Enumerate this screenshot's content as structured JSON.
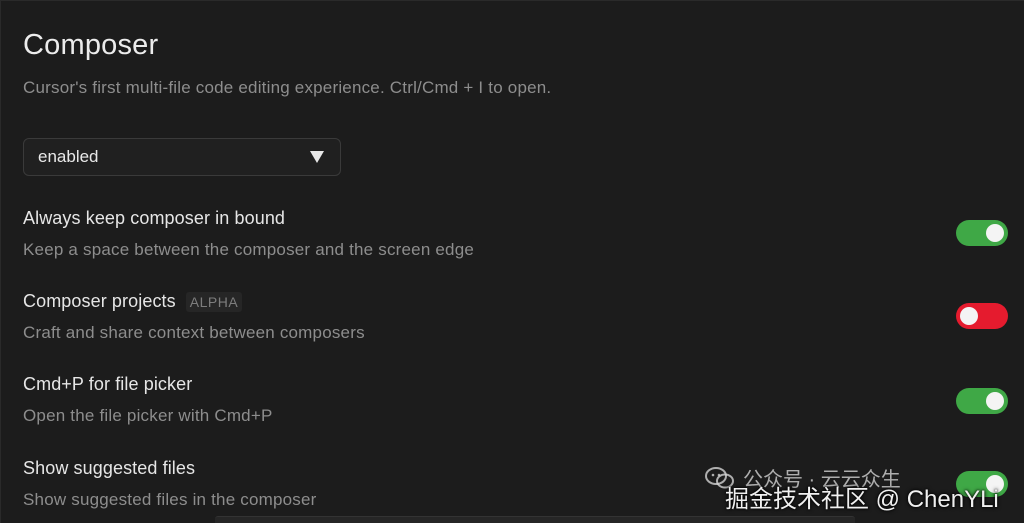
{
  "section": {
    "title": "Composer",
    "subtitle": "Cursor's first multi-file code editing experience. Ctrl/Cmd + I to open."
  },
  "mode_select": {
    "value": "enabled"
  },
  "settings": [
    {
      "label": "Always keep composer in bound",
      "description": "Keep a space between the composer and the screen edge",
      "badge": "",
      "enabled": true
    },
    {
      "label": "Composer projects",
      "description": "Craft and share context between composers",
      "badge": "ALPHA",
      "enabled": false
    },
    {
      "label": "Cmd+P for file picker",
      "description": "Open the file picker with Cmd+P",
      "badge": "",
      "enabled": true
    },
    {
      "label": "Show suggested files",
      "description": "Show suggested files in the composer",
      "badge": "",
      "enabled": true
    }
  ],
  "colors": {
    "toggle_on": "#3fa846",
    "toggle_off": "#e51b2e",
    "background": "#1c1c1c"
  },
  "watermark": {
    "line1": "公众号 · 云云众生",
    "line2": "掘金技术社区 @ ChenYLi",
    "icon": "wechat-icon"
  }
}
